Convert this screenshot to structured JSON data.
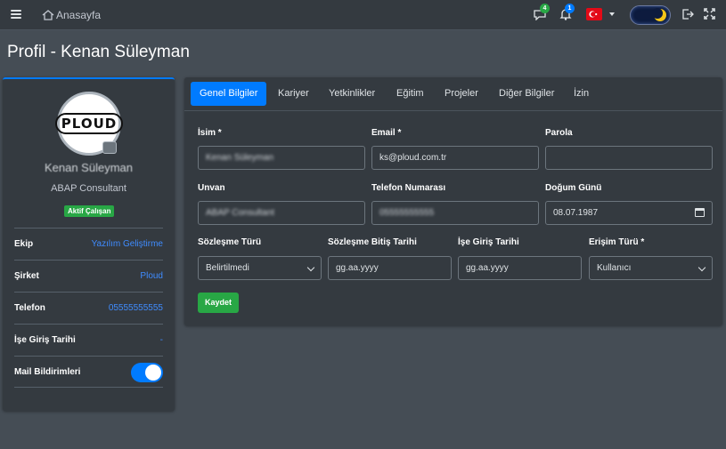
{
  "topnav": {
    "home_label": "Anasayfa",
    "messages_count": "4",
    "notifications_count": "1",
    "language_flag": "tr-flag-icon"
  },
  "page": {
    "title": "Profil - Kenan Süleyman"
  },
  "profile": {
    "avatar_text": "PLOUD",
    "name": "Kenan Süleyman",
    "role": "ABAP Consultant",
    "status": "Aktif Çalışan",
    "rows": [
      {
        "label": "Ekip",
        "value": "Yazılım Geliştirme"
      },
      {
        "label": "Şirket",
        "value": "Ploud"
      },
      {
        "label": "Telefon",
        "value": "05555555555"
      },
      {
        "label": "İşe Giriş Tarihi",
        "value": "-"
      },
      {
        "label": "Mail Bildirimleri",
        "value": ""
      }
    ],
    "mail_notifications_on": true
  },
  "tabs": [
    {
      "label": "Genel Bilgiler",
      "active": true
    },
    {
      "label": "Kariyer",
      "active": false
    },
    {
      "label": "Yetkinlikler",
      "active": false
    },
    {
      "label": "Eğitim",
      "active": false
    },
    {
      "label": "Projeler",
      "active": false
    },
    {
      "label": "Diğer Bilgiler",
      "active": false
    },
    {
      "label": "İzin",
      "active": false
    }
  ],
  "form": {
    "name_label": "İsim *",
    "name_value": "Kenan Süleyman",
    "email_label": "Email *",
    "email_value": "ks@ploud.com.tr",
    "password_label": "Parola",
    "password_value": "",
    "title_label": "Unvan",
    "title_value": "ABAP Consultant",
    "phone_label": "Telefon Numarası",
    "phone_value": "05555555555",
    "birthdate_label": "Doğum Günü",
    "birthdate_value": "08.07.1987",
    "contract_type_label": "Sözleşme Türü",
    "contract_type_value": "Belirtilmedi",
    "contract_end_label": "Sözleşme Bitiş Tarihi",
    "contract_end_placeholder": "gg.aa.yyyy",
    "start_date_label": "İşe Giriş Tarihi",
    "start_date_placeholder": "gg.aa.yyyy",
    "access_type_label": "Erişim Türü *",
    "access_type_value": "Kullanıcı",
    "save_label": "Kaydet"
  },
  "colors": {
    "accent": "#007bff",
    "success": "#28a745",
    "background": "#454d55",
    "card": "#343a40"
  }
}
